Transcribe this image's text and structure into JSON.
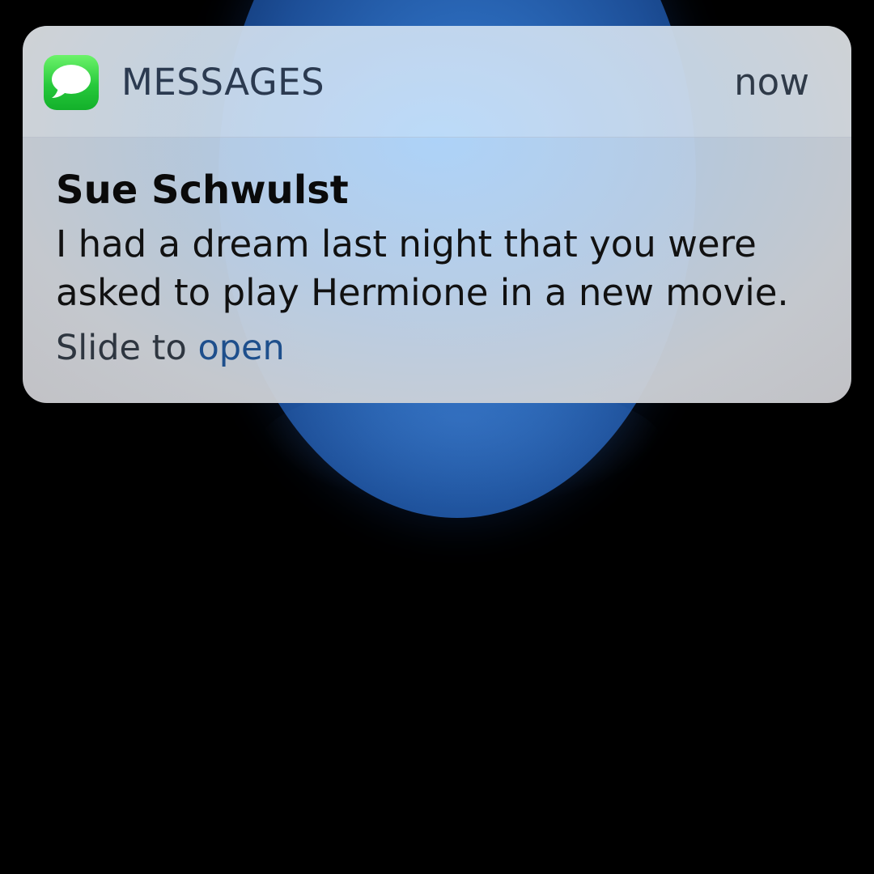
{
  "notification": {
    "app_icon": "messages-icon",
    "app_name": "MESSAGES",
    "timestamp": "now",
    "sender": "Sue Schwulst",
    "message": "I had a dream last night that you were asked to play Hermione in a new movie.",
    "slide_prefix": "Slide to ",
    "slide_action": "open"
  },
  "colors": {
    "background": "#000000",
    "app_icon_green": "#27c93c",
    "action_blue": "#1e4f8c",
    "planet_blue": "#2a68b8"
  }
}
